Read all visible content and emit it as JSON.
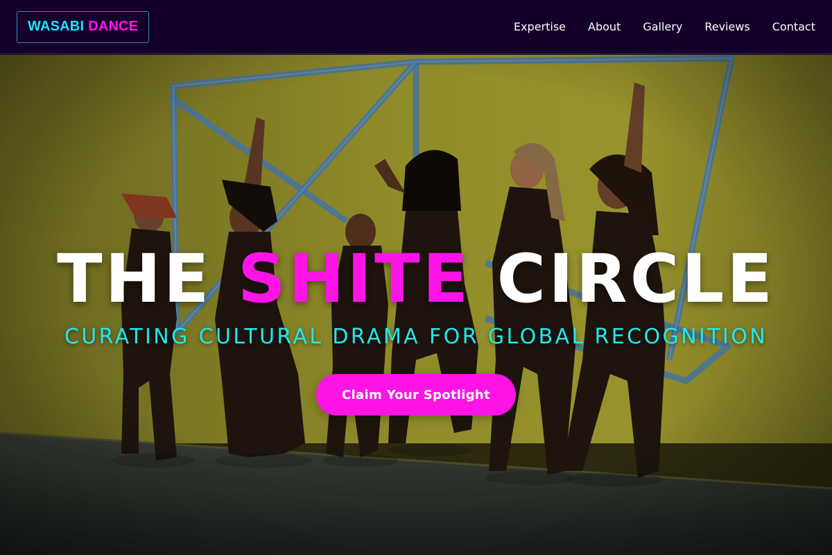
{
  "brand": {
    "first": "WASABI",
    "second": "DANCE"
  },
  "nav": {
    "items": [
      {
        "label": "Expertise"
      },
      {
        "label": "About"
      },
      {
        "label": "Gallery"
      },
      {
        "label": "Reviews"
      },
      {
        "label": "Contact"
      }
    ]
  },
  "hero": {
    "title_start": "THE ",
    "title_highlight": "SHITE",
    "title_end": " CIRCLE",
    "subtitle": "CURATING CULTURAL DRAMA FOR GLOBAL RECOGNITION",
    "cta_label": "Claim Your Spotlight"
  },
  "colors": {
    "nav_bg": "#14002a",
    "accent_pink": "#ff14e8",
    "accent_cyan": "#1fe9ef",
    "wall": "#c9c235"
  }
}
